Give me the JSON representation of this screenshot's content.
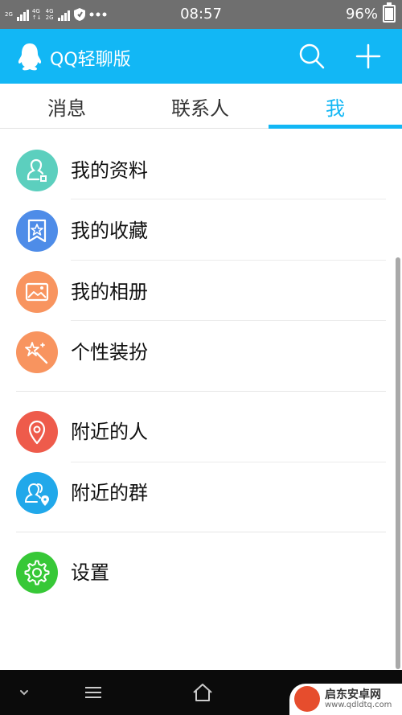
{
  "status_bar": {
    "sim1_network": "2G",
    "sim2_network_a": "4G",
    "sim2_network_b": "2G",
    "time": "08:57",
    "battery": "96%"
  },
  "header": {
    "title": "QQ轻聊版"
  },
  "tabs": [
    {
      "label": "消息",
      "active": false
    },
    {
      "label": "联系人",
      "active": false
    },
    {
      "label": "我",
      "active": true
    }
  ],
  "menu": [
    {
      "label": "我的资料",
      "icon": "profile-card-icon",
      "color": "#5ccfbe"
    },
    {
      "label": "我的收藏",
      "icon": "star-bookmark-icon",
      "color": "#4e8ce8"
    },
    {
      "label": "我的相册",
      "icon": "photo-icon",
      "color": "#f8945f"
    },
    {
      "label": "个性装扮",
      "icon": "magic-wand-icon",
      "color": "#f8945f"
    },
    {
      "label": "附近的人",
      "icon": "location-pin-icon",
      "color": "#ee5b4b"
    },
    {
      "label": "附近的群",
      "icon": "nearby-group-icon",
      "color": "#21a8ea"
    },
    {
      "label": "设置",
      "icon": "gear-icon",
      "color": "#37c837"
    }
  ],
  "colors": {
    "accent": "#12b7f5",
    "status_bar": "#6f6f6f",
    "nav_bar": "#0b0b0b"
  },
  "watermark": {
    "name": "启东安卓网",
    "url": "www.qdldtq.com"
  }
}
